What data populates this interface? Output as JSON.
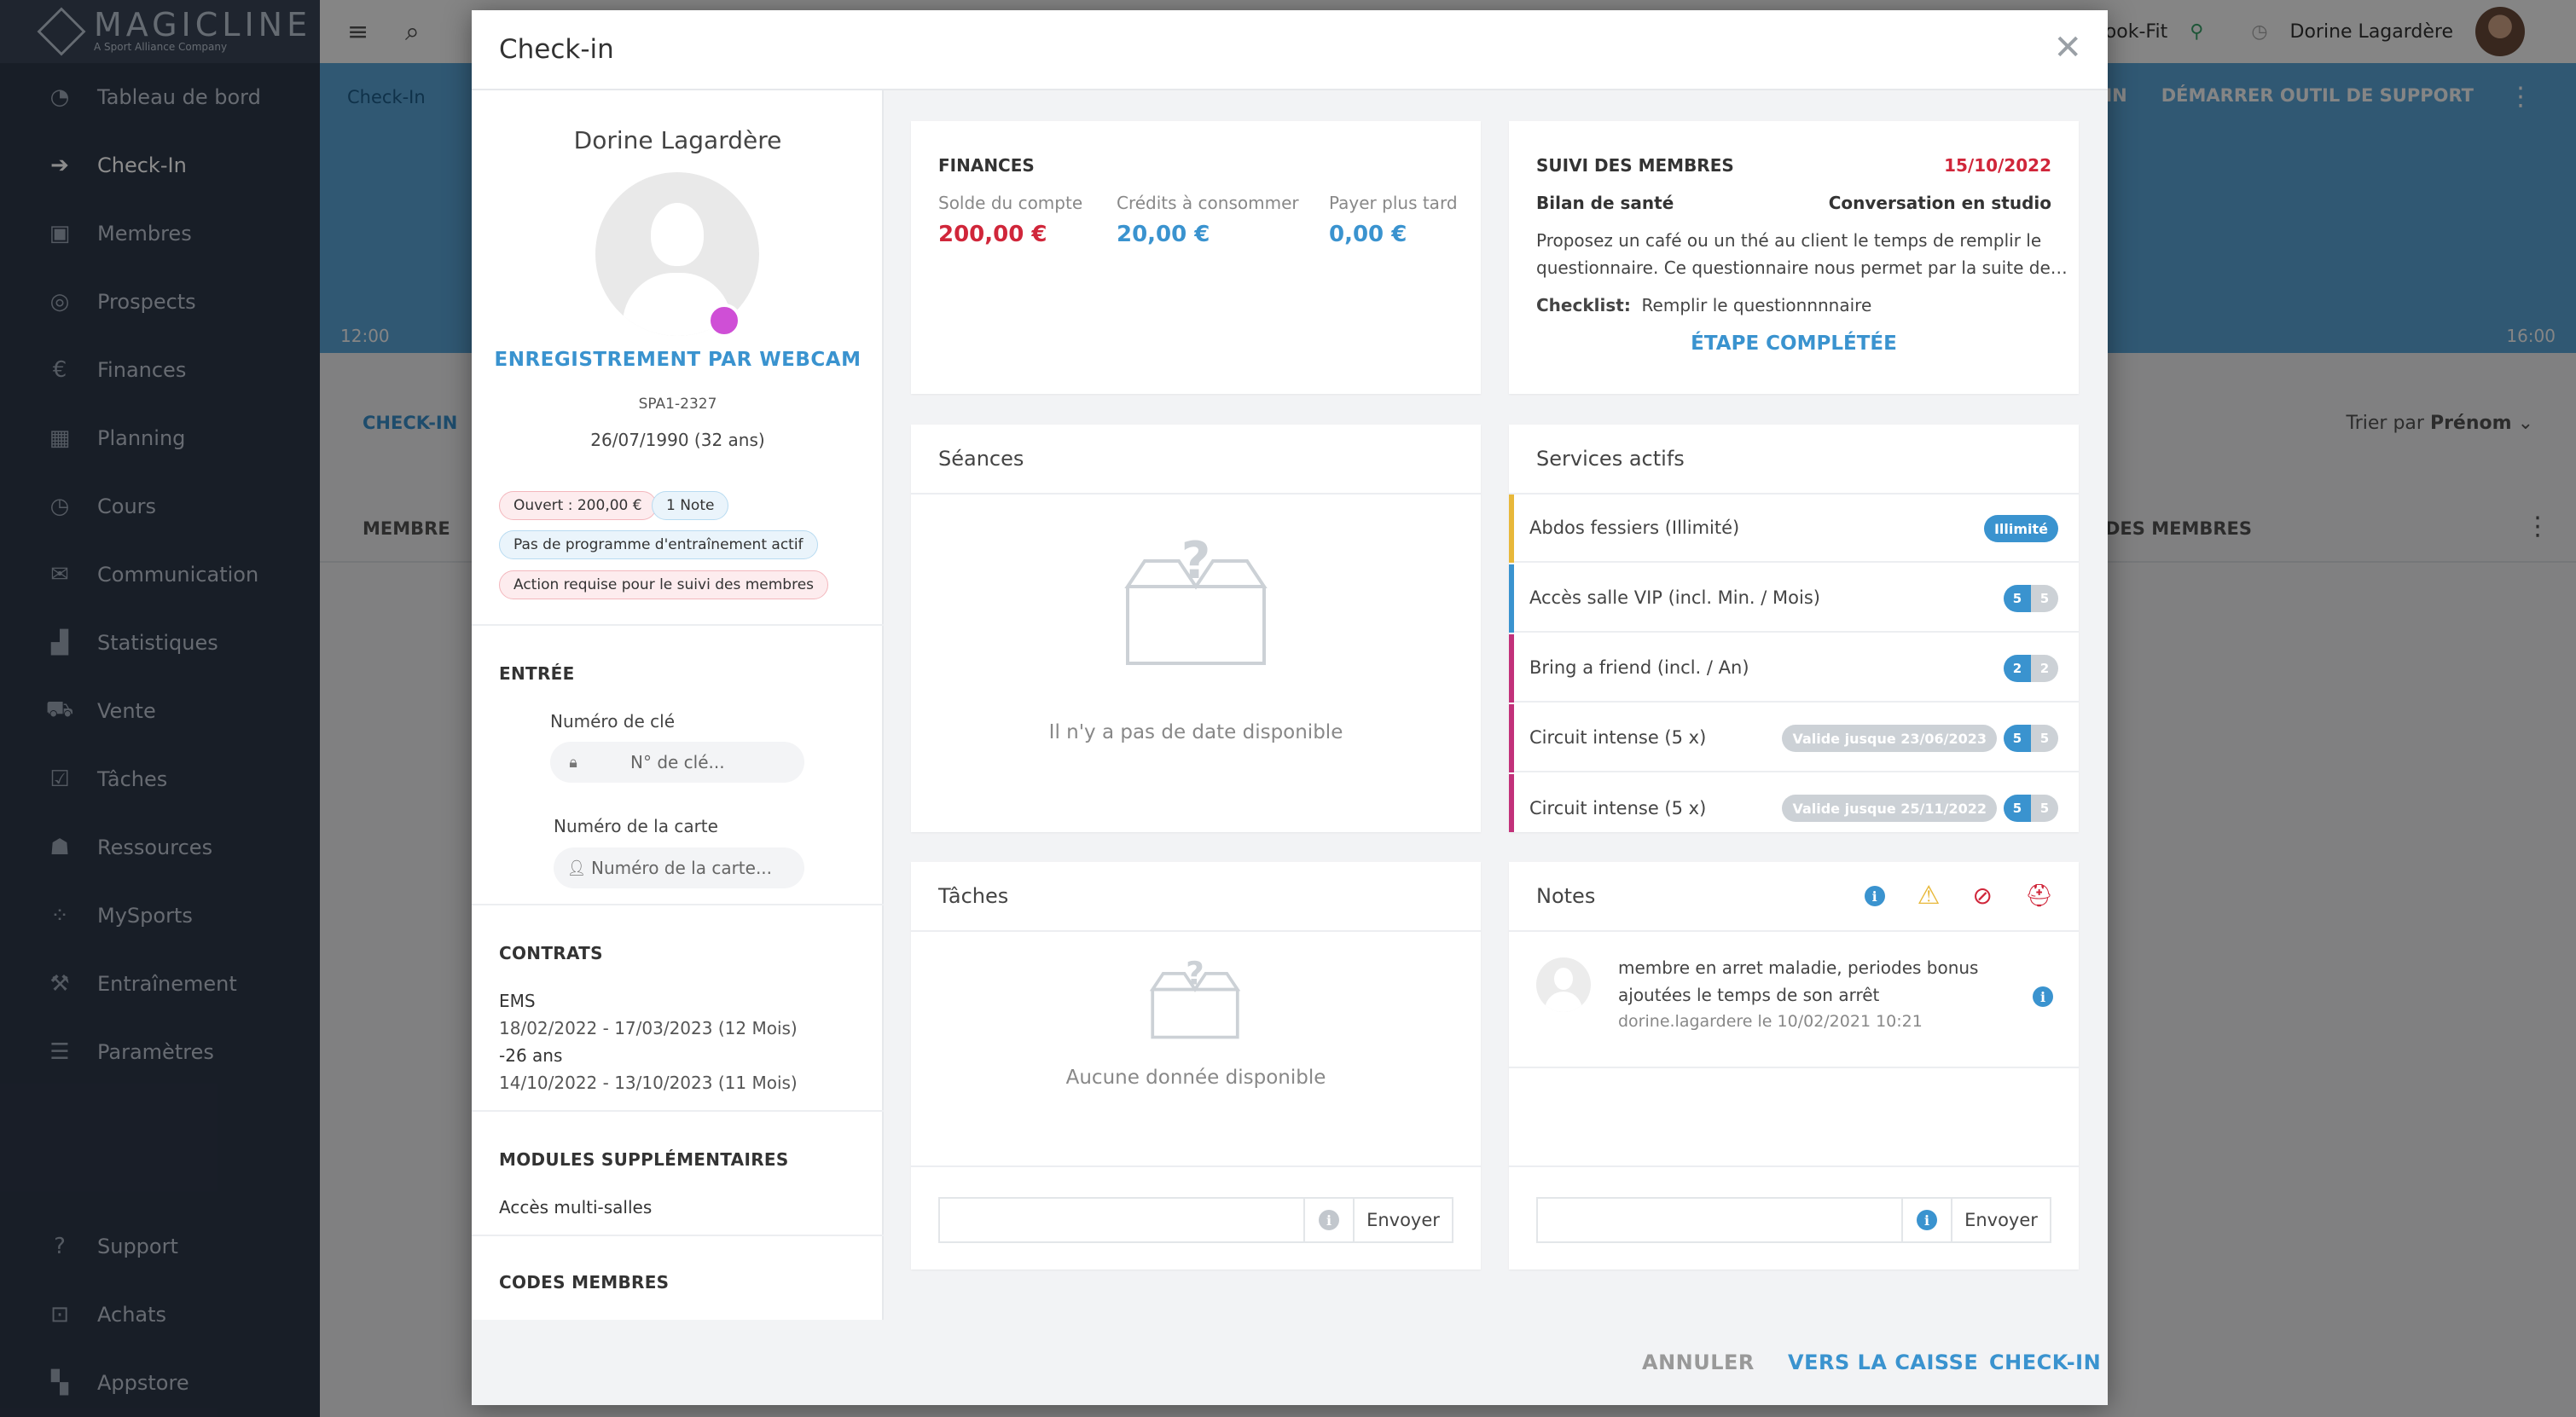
{
  "sidebar": {
    "brand": "MAGICLINE",
    "brand_sub": "A Sport Alliance Company",
    "items": [
      {
        "label": "Tableau de bord"
      },
      {
        "label": "Check-In"
      },
      {
        "label": "Membres"
      },
      {
        "label": "Prospects"
      },
      {
        "label": "Finances"
      },
      {
        "label": "Planning"
      },
      {
        "label": "Cours"
      },
      {
        "label": "Communication"
      },
      {
        "label": "Statistiques"
      },
      {
        "label": "Vente"
      },
      {
        "label": "Tâches"
      },
      {
        "label": "Ressources"
      },
      {
        "label": "MySports"
      },
      {
        "label": "Entraînement"
      },
      {
        "label": "Paramètres"
      }
    ],
    "bottom_items": [
      {
        "label": "Support"
      },
      {
        "label": "Achats"
      },
      {
        "label": "Appstore"
      }
    ]
  },
  "topbar": {
    "studio": "Book-Fit",
    "user": "Dorine Lagardère"
  },
  "background": {
    "breadcrumb": "Check-In",
    "time_start": "12:00",
    "time_end": "16:00",
    "header_link_1": "CHECK-IN",
    "header_link_2": "DÉMARRER OUTIL DE SUPPORT",
    "tab_checkin": "CHECK-IN",
    "sort_label": "Trier par",
    "sort_value": "Prénom",
    "col_membre": "MEMBRE",
    "col_codes": "CODES MEMBRES"
  },
  "modal": {
    "title": "Check-in",
    "footer": {
      "cancel": "ANNULER",
      "to_checkout": "VERS LA CAISSE",
      "checkin": "CHECK-IN"
    }
  },
  "member": {
    "name": "Dorine Lagardère",
    "webcam_label": "ENREGISTREMENT PAR WEBCAM",
    "id": "SPA1-2327",
    "dob": "26/07/1990 (32 ans)",
    "tags": {
      "open": "Ouvert : 200,00 €",
      "note": "1 Note",
      "no_program": "Pas de programme d'entraînement actif",
      "action": "Action requise pour le suivi des membres"
    },
    "entry": {
      "title": "ENTRÉE",
      "key_label": "Numéro de clé",
      "key_placeholder": "N° de clé...",
      "card_label": "Numéro de la carte",
      "card_placeholder": "Numéro de la carte..."
    },
    "contracts": {
      "title": "CONTRATS",
      "name": "EMS",
      "period_1": "18/02/2022 - 17/03/2023 (12 Mois)",
      "name_2": "-26 ans",
      "period_2": "14/10/2022 - 13/10/2023 (11 Mois)"
    },
    "modules": {
      "title": "MODULES SUPPLÉMENTAIRES",
      "item": "Accès multi-salles"
    },
    "codes_title": "CODES MEMBRES"
  },
  "finances": {
    "title": "FINANCES",
    "balance_label": "Solde du compte",
    "balance": "200,00 €",
    "credits_label": "Crédits à consommer",
    "credits": "20,00 €",
    "later_label": "Payer plus tard",
    "later": "0,00 €"
  },
  "suivi": {
    "title": "SUIVI DES MEMBRES",
    "date": "15/10/2022",
    "subtitle": "Bilan de santé",
    "type": "Conversation en studio",
    "text_1": "Proposez un café ou un thé au client le temps de remplir le",
    "text_2": "questionnaire. Ce questionnaire nous permet par la suite de…",
    "checklist_label": "Checklist:",
    "checklist_value": "Remplir le questionnnnaire",
    "done_button": "ÉTAPE COMPLÉTÉE"
  },
  "seances": {
    "title": "Séances",
    "empty": "Il n'y a pas de date disponible"
  },
  "services": {
    "title": "Services actifs",
    "rows": [
      {
        "name": "Abdos fessiers (Illimité)",
        "badge": "Illimité",
        "color": "#e8b83a"
      },
      {
        "name": "Accès salle VIP (incl. Min. / Mois)",
        "a": "5",
        "b": "5",
        "color": "#3a93cf"
      },
      {
        "name": "Bring a friend (incl. / An)",
        "a": "2",
        "b": "2",
        "color": "#c2317a"
      },
      {
        "name": "Circuit intense (5 x)",
        "valid": "Valide jusque 23/06/2023",
        "a": "5",
        "b": "5",
        "color": "#c2317a"
      },
      {
        "name": "Circuit intense (5 x)",
        "valid": "Valide jusque 25/11/2022",
        "a": "5",
        "b": "5",
        "color": "#c2317a"
      }
    ]
  },
  "taches": {
    "title": "Tâches",
    "empty": "Aucune donnée disponible",
    "send": "Envoyer"
  },
  "notes": {
    "title": "Notes",
    "text_1": "membre en arret maladie, periodes bonus",
    "text_2": "ajoutées le temps de son arrêt",
    "author": "dorine.lagardere le 10/02/2021 10:21",
    "send": "Envoyer"
  },
  "colors": {
    "accent": "#3a93cf",
    "danger": "#d0263a",
    "sidebar": "#2d3748"
  }
}
